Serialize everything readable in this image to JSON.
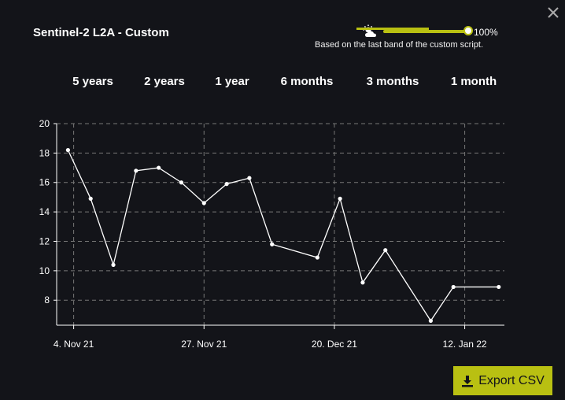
{
  "header": {
    "title": "Sentinel-2 L2A - Custom",
    "cloud_coverage_label": "100%",
    "cloud_coverage_value": 100,
    "note": "Based on the last band of the custom script."
  },
  "tabs": [
    {
      "label": "5 years",
      "selected": false
    },
    {
      "label": "2 years",
      "selected": false
    },
    {
      "label": "1 year",
      "selected": false
    },
    {
      "label": "6 months",
      "selected": false
    },
    {
      "label": "3 months",
      "selected": true
    },
    {
      "label": "1 month",
      "selected": false
    }
  ],
  "colors": {
    "accent": "#b9c012",
    "background": "#131419",
    "line": "#ffffff",
    "grid": "#777777"
  },
  "chart_data": {
    "type": "line",
    "title": "",
    "xlabel": "",
    "ylabel": "",
    "x": [
      "2021-11-03",
      "2021-11-07",
      "2021-11-11",
      "2021-11-15",
      "2021-11-19",
      "2021-11-23",
      "2021-11-27",
      "2021-12-01",
      "2021-12-05",
      "2021-12-09",
      "2021-12-17",
      "2021-12-21",
      "2021-12-25",
      "2021-12-29",
      "2022-01-06",
      "2022-01-10",
      "2022-01-18"
    ],
    "x_ticks": [
      "4. Nov 21",
      "27. Nov 21",
      "20. Dec 21",
      "12. Jan 22"
    ],
    "x_tick_dates": [
      "2021-11-04",
      "2021-11-27",
      "2021-12-20",
      "2022-01-12"
    ],
    "y_ticks": [
      8,
      10,
      12,
      14,
      16,
      18,
      20
    ],
    "ylim": [
      6.3,
      20
    ],
    "xlim": [
      "2021-11-01",
      "2022-01-19"
    ],
    "grid": true,
    "series": [
      {
        "values": [
          18.2,
          14.9,
          10.4,
          16.8,
          17.0,
          16.0,
          14.6,
          15.9,
          16.3,
          11.8,
          10.9,
          14.9,
          9.2,
          11.4,
          6.6,
          8.9,
          8.9
        ]
      }
    ]
  },
  "export": {
    "label": "Export CSV"
  }
}
